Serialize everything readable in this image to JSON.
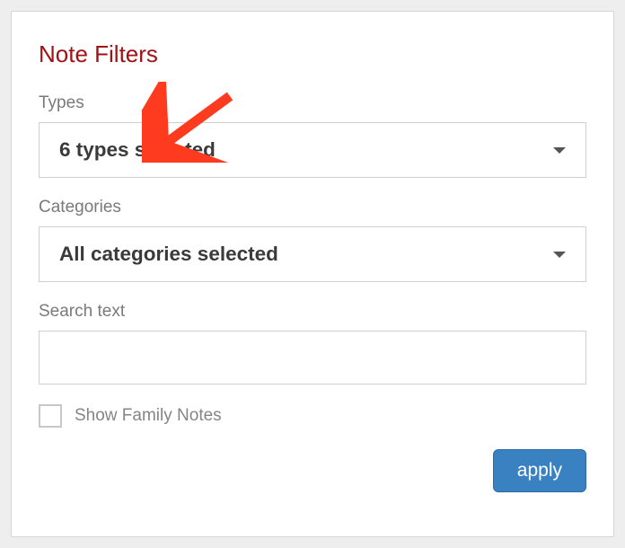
{
  "title": "Note Filters",
  "types": {
    "label": "Types",
    "selected_text": "6 types selected"
  },
  "categories": {
    "label": "Categories",
    "selected_text": "All categories selected"
  },
  "search": {
    "label": "Search text",
    "value": ""
  },
  "show_family_notes": {
    "label": "Show Family Notes",
    "checked": false
  },
  "apply_label": "apply",
  "colors": {
    "title": "#a11216",
    "apply_bg": "#3a81c2",
    "annotation": "#ff3b1f"
  }
}
